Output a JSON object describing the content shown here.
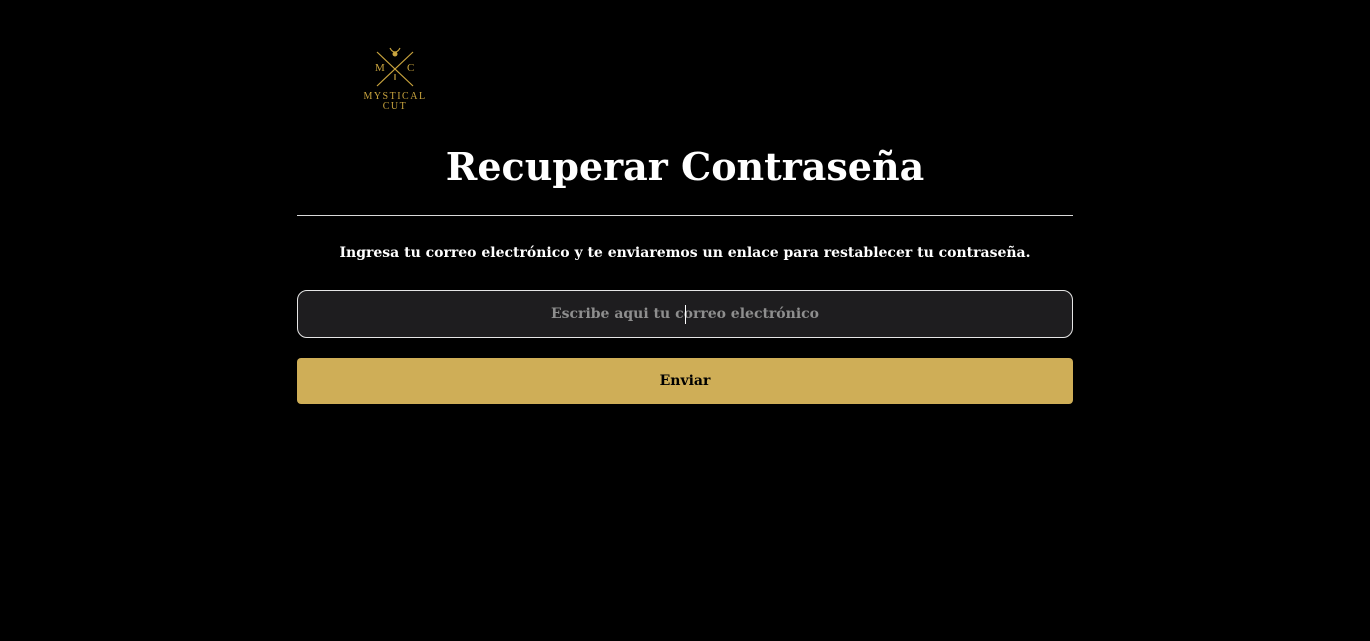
{
  "logo": {
    "letter_left": "M",
    "letter_right": "C",
    "line1": "MYSTICAL",
    "line2": "CUT",
    "icon": "crossed-scissors-bull-icon",
    "color": "#c9a43e"
  },
  "page": {
    "title": "Recuperar Contraseña",
    "subtitle": "Ingresa tu correo electrónico y te enviaremos un enlace para restablecer tu contraseña."
  },
  "form": {
    "email": {
      "value": "",
      "placeholder": "Escribe aqui tu correo electrónico"
    },
    "submit_label": "Enviar"
  },
  "colors": {
    "background": "#000000",
    "accent": "#cfae57",
    "input_background": "#1e1d1f",
    "text": "#ffffff"
  }
}
